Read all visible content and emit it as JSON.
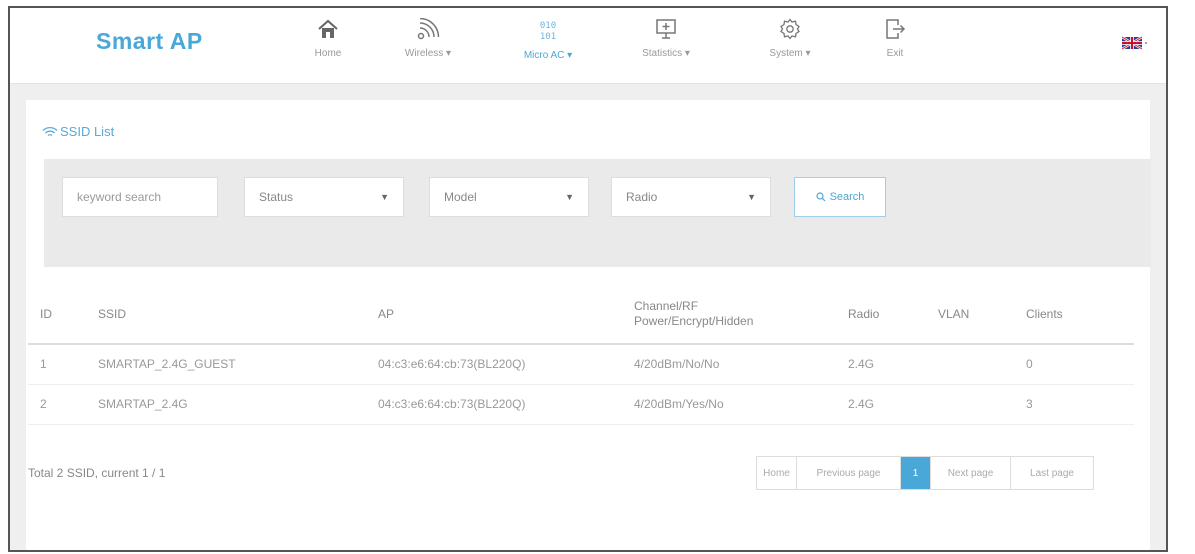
{
  "brand": "Smart AP",
  "nav": [
    {
      "label": "Home",
      "icon": "home-icon"
    },
    {
      "label": "Wireless ▾",
      "icon": "wifi-icon"
    },
    {
      "label": "Micro AC ▾",
      "icon": "binary-icon"
    },
    {
      "label": "Statistics ▾",
      "icon": "monitor-icon"
    },
    {
      "label": "System ▾",
      "icon": "gear-icon"
    },
    {
      "label": "Exit",
      "icon": "exit-icon"
    }
  ],
  "panel_title": "SSID List",
  "filters": {
    "keyword_placeholder": "keyword search",
    "status": "Status",
    "model": "Model",
    "radio": "Radio",
    "search_label": "Search"
  },
  "table": {
    "headers": {
      "id": "ID",
      "ssid": "SSID",
      "ap": "AP",
      "channel_line1": "Channel/RF",
      "channel_line2": "Power/Encrypt/Hidden",
      "radio": "Radio",
      "vlan": "VLAN",
      "clients": "Clients"
    },
    "rows": [
      {
        "id": "1",
        "ssid": "SMARTAP_2.4G_GUEST",
        "ap": "04:c3:e6:64:cb:73(BL220Q)",
        "channel": "4/20dBm/No/No",
        "radio": "2.4G",
        "vlan": "",
        "clients": "0"
      },
      {
        "id": "2",
        "ssid": "SMARTAP_2.4G",
        "ap": "04:c3:e6:64:cb:73(BL220Q)",
        "channel": "4/20dBm/Yes/No",
        "radio": "2.4G",
        "vlan": "",
        "clients": "3"
      }
    ]
  },
  "total": "Total 2 SSID,  current 1 / 1",
  "pagination": {
    "home": "Home",
    "previous": "Previous page",
    "current": "1",
    "next": "Next page",
    "last": "Last page"
  },
  "colors": {
    "accent": "#4aa8d8"
  }
}
